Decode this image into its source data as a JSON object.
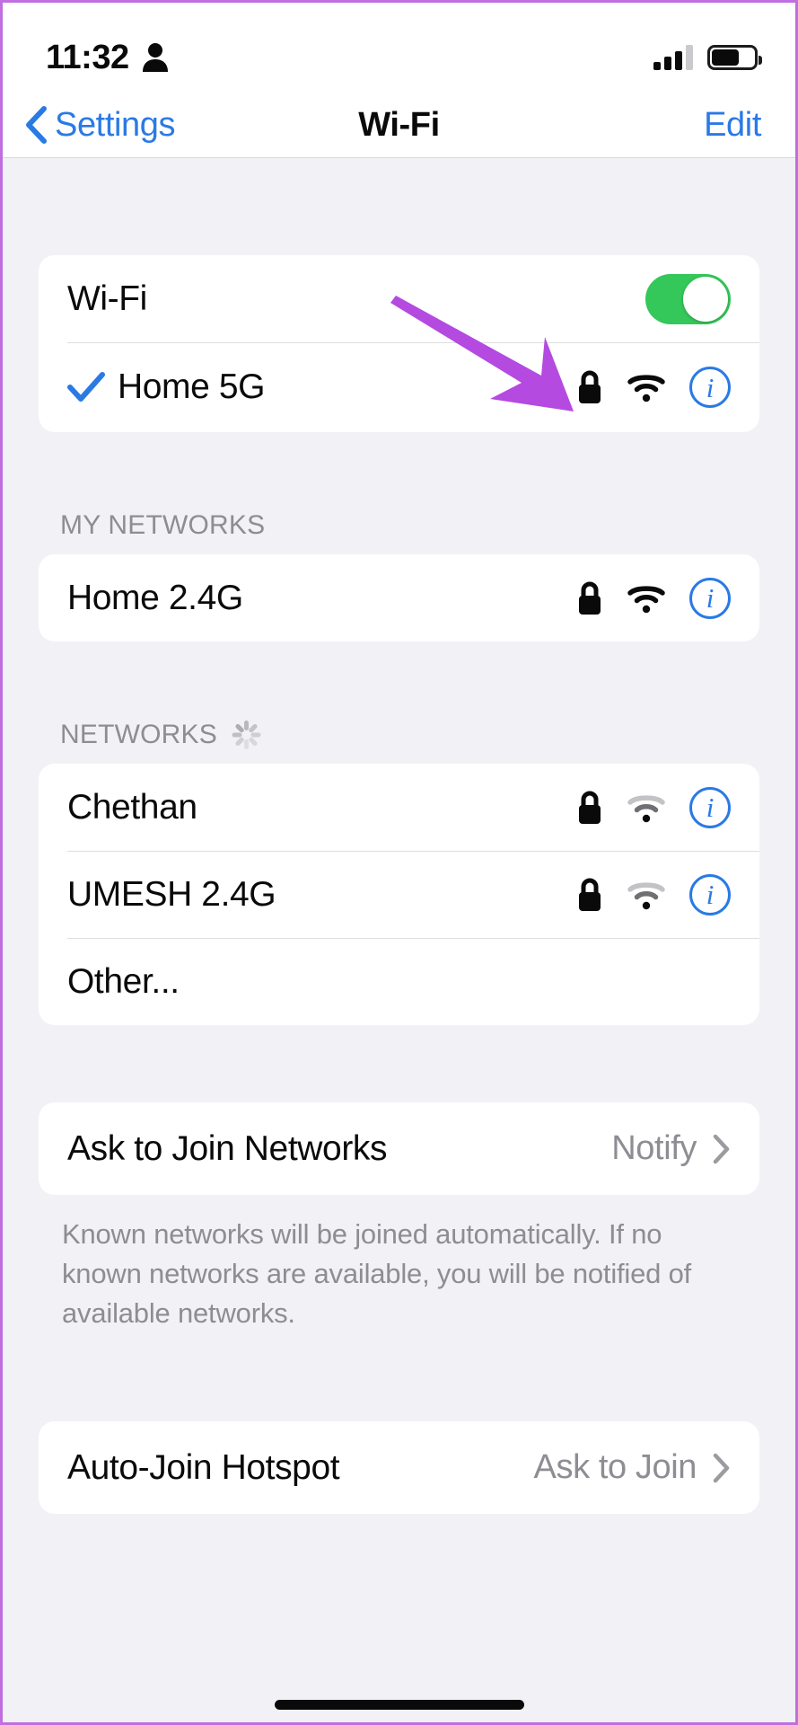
{
  "status_bar": {
    "time": "11:32",
    "person_icon": "person-icon",
    "signal_icon": "cellular-signal-icon",
    "signal_bars_filled": 3,
    "signal_bars_total": 4,
    "battery_icon": "battery-icon",
    "battery_percent": 65
  },
  "nav_bar": {
    "back_label": "Settings",
    "back_icon": "chevron-left-icon",
    "title": "Wi-Fi",
    "edit_label": "Edit"
  },
  "wifi_section": {
    "toggle_label": "Wi-Fi",
    "toggle_on": true,
    "connected_network": {
      "name": "Home 5G",
      "checked": true,
      "lock": true,
      "signal": "strong",
      "info": "i"
    }
  },
  "my_networks": {
    "header": "MY NETWORKS",
    "networks": [
      {
        "name": "Home 2.4G",
        "lock": true,
        "signal": "strong",
        "info": "i"
      }
    ]
  },
  "networks": {
    "header": "NETWORKS",
    "scanning": true,
    "networks": [
      {
        "name": "Chethan",
        "lock": true,
        "signal": "weak",
        "info": "i"
      },
      {
        "name": "UMESH 2.4G",
        "lock": true,
        "signal": "weak",
        "info": "i"
      }
    ],
    "other_label": "Other..."
  },
  "ask_to_join": {
    "label": "Ask to Join Networks",
    "value": "Notify",
    "chevron": "chevron-right-icon",
    "footnote": "Known networks will be joined automatically. If no known networks are available, you will be notified of available networks."
  },
  "auto_join_hotspot": {
    "label": "Auto-Join Hotspot",
    "value": "Ask to Join",
    "chevron": "chevron-right-icon"
  },
  "annotation": {
    "arrow_color": "#b44ae0",
    "arrow_target": "lock-icon-home-5g"
  },
  "colors": {
    "accent_blue": "#2a7ae4",
    "toggle_green": "#34c759",
    "background": "#f2f1f6",
    "card": "#ffffff",
    "secondary_text": "#8d8d93",
    "frame_border": "#c06ee0"
  }
}
